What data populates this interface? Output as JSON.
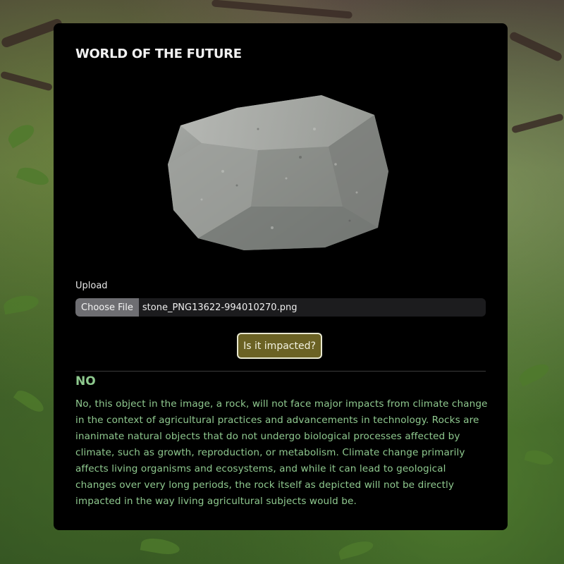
{
  "app": {
    "title": "WORLD OF THE FUTURE"
  },
  "image": {
    "subject": "rock"
  },
  "upload": {
    "label": "Upload",
    "choose_file_label": "Choose File",
    "file_name": "stone_PNG13622-994010270.png"
  },
  "actions": {
    "submit_label": "Is it impacted?"
  },
  "result": {
    "heading": "NO",
    "text": "No, this object in the image, a rock, will not face major impacts from climate change in the context of agricultural practices and advancements in technology. Rocks are inanimate natural objects that do not undergo biological processes affected by climate, such as growth, reproduction, or metabolism. Climate change primarily affects living organisms and ecosystems, and while it can lead to geological changes over very long periods, the rock itself as depicted will not be directly impacted in the way living agricultural subjects would be."
  },
  "colors": {
    "panel_background": "#000000",
    "result_color": "#8fc98f",
    "button_background": "#6b6224",
    "button_border": "#e8e8d0"
  }
}
